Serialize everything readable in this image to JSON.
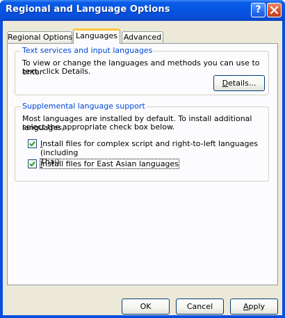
{
  "window": {
    "title": "Regional and Language Options",
    "help_label": "?",
    "close_label": "✕"
  },
  "tabs": [
    {
      "label": "Regional Options",
      "active": false
    },
    {
      "label": "Languages",
      "active": true
    },
    {
      "label": "Advanced",
      "active": false
    }
  ],
  "text_services": {
    "title": "Text services and input languages",
    "description_line1": "To view or change the languages and methods you can use to enter",
    "description_line2": "text, click Details.",
    "details_button": {
      "pre": "",
      "accel": "D",
      "post": "etails..."
    }
  },
  "supplemental": {
    "title": "Supplemental language support",
    "description_line1": "Most languages are installed by default. To install additional languages,",
    "description_line2": "select the appropriate check box below.",
    "options": [
      {
        "accel": "I",
        "label_rest_line1": "nstall files for complex script and right-to-left languages (including",
        "label_line2": "Thai)",
        "checked": true
      },
      {
        "accel": "I",
        "label_rest_line1": "nstall files for East Asian languages",
        "label_line2": "",
        "checked": true
      }
    ]
  },
  "footer": {
    "ok": "OK",
    "cancel": "Cancel",
    "apply_accel": "A",
    "apply_rest": "pply"
  },
  "colors": {
    "title_bar": "#0554e2",
    "group_title": "#0046d5",
    "tab_highlight": "#ffc83c",
    "dialog_face": "#ece9d8"
  }
}
